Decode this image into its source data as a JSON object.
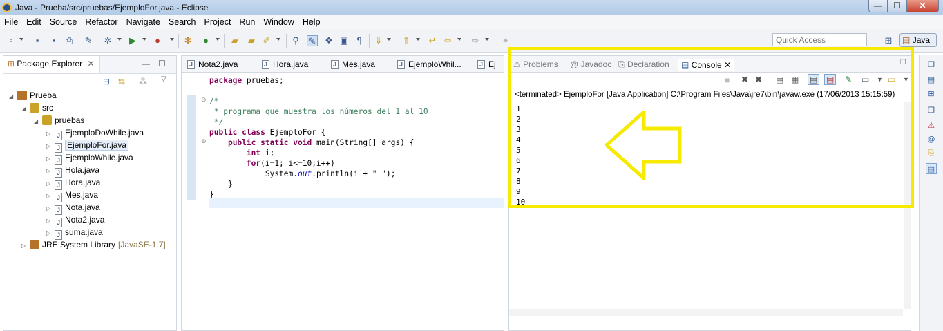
{
  "window": {
    "title": "Java - Prueba/src/pruebas/EjemploFor.java - Eclipse",
    "minimize": "—",
    "maximize": "☐",
    "close": "✕"
  },
  "menu": [
    "File",
    "Edit",
    "Source",
    "Refactor",
    "Navigate",
    "Search",
    "Project",
    "Run",
    "Window",
    "Help"
  ],
  "toolbar": {
    "quick_access": "Quick Access",
    "perspective": "Java"
  },
  "package_explorer": {
    "title": "Package Explorer",
    "tree": [
      {
        "label": "Prueba",
        "level": 0,
        "icon": "project-icon"
      },
      {
        "label": "src",
        "level": 1,
        "icon": "source-folder-icon"
      },
      {
        "label": "pruebas",
        "level": 2,
        "icon": "package-icon"
      },
      {
        "label": "EjemploDoWhile.java",
        "level": 3,
        "icon": "java-file-icon"
      },
      {
        "label": "EjemploFor.java",
        "level": 3,
        "icon": "java-file-icon",
        "selected": true
      },
      {
        "label": "EjemploWhile.java",
        "level": 3,
        "icon": "java-file-icon"
      },
      {
        "label": "Hola.java",
        "level": 3,
        "icon": "java-file-icon"
      },
      {
        "label": "Hora.java",
        "level": 3,
        "icon": "java-file-icon"
      },
      {
        "label": "Mes.java",
        "level": 3,
        "icon": "java-file-icon"
      },
      {
        "label": "Nota.java",
        "level": 3,
        "icon": "java-file-icon"
      },
      {
        "label": "Nota2.java",
        "level": 3,
        "icon": "java-file-icon"
      },
      {
        "label": "suma.java",
        "level": 3,
        "icon": "java-file-icon"
      },
      {
        "label": "JRE System Library",
        "suffix": "[JavaSE-1.7]",
        "level": 1,
        "icon": "library-icon"
      }
    ]
  },
  "editor": {
    "tabs": [
      "Nota2.java",
      "Hora.java",
      "Mes.java",
      "EjemploWhil...",
      "Ej"
    ],
    "code": [
      "package pruebas;",
      "",
      "/*",
      " * programa que muestra los números del 1 al 10",
      " */",
      "public class EjemploFor {",
      "    public static void main(String[] args) {",
      "        int i;",
      "        for(i=1; i<=10;i++)",
      "            System.out.println(i + \" \");",
      "    }",
      "}"
    ]
  },
  "console": {
    "tabs": [
      "Problems",
      "Javadoc",
      "Declaration",
      "Console"
    ],
    "status": "<terminated> EjemploFor [Java Application] C:\\Program Files\\Java\\jre7\\bin\\javaw.exe (17/06/2013 15:15:59)",
    "output": [
      "1",
      "2",
      "3",
      "4",
      "5",
      "6",
      "7",
      "8",
      "9",
      "10"
    ]
  },
  "colors": {
    "highlight": "#f5ea00",
    "keyword": "#7f0055",
    "comment": "#3f7f5f"
  }
}
